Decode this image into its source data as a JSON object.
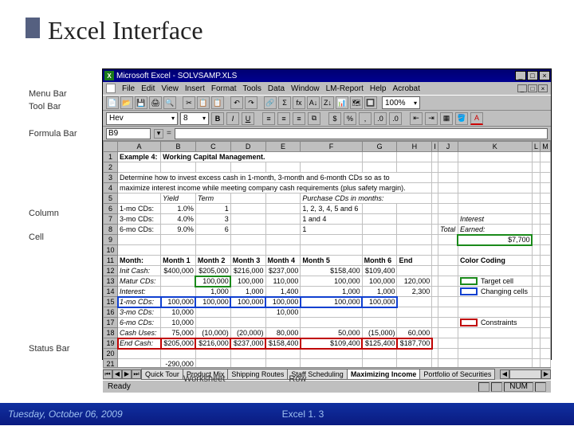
{
  "slide": {
    "title": "Excel Interface"
  },
  "annotations": {
    "menubar": "Menu Bar",
    "toolbar": "Tool Bar",
    "formulabar": "Formula Bar",
    "column": "Column",
    "cell": "Cell",
    "statusbar": "Status Bar",
    "worksheet": "Worksheet",
    "row": "Row"
  },
  "title": {
    "app": "Microsoft Excel",
    "file": "SOLVSAMP.XLS"
  },
  "winbtns": {
    "min": "_",
    "max": "□",
    "close": "×"
  },
  "menubar": {
    "items": [
      "File",
      "Edit",
      "View",
      "Insert",
      "Format",
      "Tools",
      "Data",
      "Window",
      "LM-Report",
      "Help",
      "Acrobat"
    ]
  },
  "toolbar": {
    "icons": [
      "📄",
      "📂",
      "💾",
      "🖨",
      "🔍",
      "✂",
      "📋",
      "📋",
      "↶",
      "↷",
      "🔗",
      "Σ",
      "fx",
      "A↓",
      "Z↓",
      "📊",
      "🗺",
      "🔲"
    ],
    "zoom": "100%"
  },
  "fmt": {
    "font": "Hev",
    "size": "8",
    "buttons": [
      "B",
      "I",
      "U"
    ],
    "align": [
      "≡",
      "≡",
      "≡",
      "≡"
    ],
    "money": "$",
    "pct": "%",
    "comma": ",",
    "fontcolor": "A"
  },
  "formula": {
    "cell": "B9",
    "eq": "="
  },
  "cols": [
    "A",
    "B",
    "C",
    "D",
    "E",
    "F",
    "G",
    "H",
    "I",
    "J",
    "K",
    "L",
    "M"
  ],
  "rows": [
    {
      "n": "1",
      "cells": [
        {
          "v": "Example 4:",
          "b": true
        },
        {
          "v": "Working Capital Management.",
          "b": true,
          "span": 5
        }
      ]
    },
    {
      "n": "2",
      "cells": []
    },
    {
      "n": "3",
      "cells": [
        {
          "span": 8,
          "v": "Determine how to invest excess cash in 1-month, 3-month and 6-month CDs so as to"
        }
      ]
    },
    {
      "n": "4",
      "cells": [
        {
          "span": 8,
          "v": "maximize interest income while meeting company cash requirements (plus safety margin)."
        }
      ]
    },
    {
      "n": "5",
      "cells": [
        {},
        {
          "v": "Yield",
          "i": true
        },
        {
          "v": "Term",
          "i": true
        },
        {},
        {},
        {
          "v": "Purchase CDs in months:",
          "i": true,
          "span": 3
        }
      ]
    },
    {
      "n": "6",
      "cells": [
        {
          "v": "1-mo CDs:"
        },
        {
          "v": "1.0%",
          "n": true
        },
        {
          "v": "1",
          "n": true
        },
        {},
        {},
        {
          "v": "1, 2, 3, 4, 5 and 6"
        }
      ]
    },
    {
      "n": "7",
      "cells": [
        {
          "v": "3-mo CDs:"
        },
        {
          "v": "4.0%",
          "n": true
        },
        {
          "v": "3",
          "n": true
        },
        {},
        {},
        {
          "v": "1 and 4"
        },
        {},
        {},
        {},
        {},
        {
          "v": "Interest",
          "i": true
        }
      ]
    },
    {
      "n": "8",
      "cells": [
        {
          "v": "6-mo CDs:"
        },
        {
          "v": "9.0%",
          "n": true
        },
        {
          "v": "6",
          "n": true
        },
        {},
        {},
        {
          "v": "1"
        },
        {},
        {},
        {},
        {
          "v": "Total",
          "i": true
        },
        {
          "v": "Earned:",
          "i": true
        }
      ]
    },
    {
      "n": "9",
      "cells": [
        {},
        {},
        {},
        {},
        {},
        {},
        {},
        {},
        {},
        {},
        {
          "v": "$7,700",
          "n": true,
          "green": true
        }
      ]
    },
    {
      "n": "10",
      "cells": []
    },
    {
      "n": "11",
      "cells": [
        {
          "v": "Month:",
          "b": true
        },
        {
          "v": "Month 1",
          "b": true
        },
        {
          "v": "Month 2",
          "b": true
        },
        {
          "v": "Month 3",
          "b": true
        },
        {
          "v": "Month 4",
          "b": true
        },
        {
          "v": "Month 5",
          "b": true
        },
        {
          "v": "Month 6",
          "b": true
        },
        {
          "v": "End",
          "b": true
        },
        {},
        {},
        {
          "v": "Color Coding",
          "b": true
        }
      ]
    },
    {
      "n": "12",
      "cells": [
        {
          "v": "Init Cash:",
          "i": true
        },
        {
          "v": "$400,000",
          "n": true
        },
        {
          "v": "$205,000",
          "n": true
        },
        {
          "v": "$216,000",
          "n": true
        },
        {
          "v": "$237,000",
          "n": true
        },
        {
          "v": "$158,400",
          "n": true
        },
        {
          "v": "$109,400",
          "n": true
        },
        {
          "v": ""
        }
      ]
    },
    {
      "n": "13",
      "cells": [
        {
          "v": "Matur CDs:",
          "i": true
        },
        {},
        {
          "v": "100,000",
          "n": true,
          "green": true
        },
        {
          "v": "100,000",
          "n": true
        },
        {
          "v": "110,000",
          "n": true
        },
        {
          "v": "100,000",
          "n": true
        },
        {
          "v": "100,000",
          "n": true
        },
        {
          "v": "120,000",
          "n": true
        },
        {},
        {},
        {
          "v": "",
          "legend": "green",
          "lt": "Target cell"
        }
      ]
    },
    {
      "n": "14",
      "cells": [
        {
          "v": "Interest:",
          "i": true
        },
        {},
        {
          "v": "1,000",
          "n": true
        },
        {
          "v": "1,000",
          "n": true
        },
        {
          "v": "1,400",
          "n": true
        },
        {
          "v": "1,000",
          "n": true
        },
        {
          "v": "1,000",
          "n": true
        },
        {
          "v": "2,300",
          "n": true
        },
        {},
        {},
        {
          "v": "",
          "legend": "blue",
          "lt": "Changing cells"
        }
      ]
    },
    {
      "n": "15",
      "cells": [
        {
          "v": "1-mo CDs:",
          "i": true,
          "blueRow": true
        },
        {
          "v": "100,000",
          "n": true
        },
        {
          "v": "100,000",
          "n": true
        },
        {
          "v": "100,000",
          "n": true
        },
        {
          "v": "100,000",
          "n": true
        },
        {
          "v": "100,000",
          "n": true
        },
        {
          "v": "100,000",
          "n": true
        }
      ]
    },
    {
      "n": "16",
      "cells": [
        {
          "v": "3-mo CDs:",
          "i": true
        },
        {
          "v": "10,000",
          "n": true
        },
        {},
        {},
        {
          "v": "10,000",
          "n": true
        }
      ]
    },
    {
      "n": "17",
      "cells": [
        {
          "v": "6-mo CDs:",
          "i": true
        },
        {
          "v": "10,000",
          "n": true
        },
        {},
        {},
        {},
        {},
        {},
        {},
        {},
        {},
        {
          "v": "",
          "legend": "red",
          "lt": "Constraints"
        }
      ]
    },
    {
      "n": "18",
      "cells": [
        {
          "v": "Cash Uses:",
          "i": true
        },
        {
          "v": "75,000",
          "n": true
        },
        {
          "v": "(10,000)",
          "n": true
        },
        {
          "v": "(20,000)",
          "n": true
        },
        {
          "v": "80,000",
          "n": true
        },
        {
          "v": "50,000",
          "n": true
        },
        {
          "v": "(15,000)",
          "n": true
        },
        {
          "v": "60,000",
          "n": true
        }
      ]
    },
    {
      "n": "19",
      "cells": [
        {
          "v": "End Cash:",
          "i": true,
          "redRow": true
        },
        {
          "v": "$205,000",
          "n": true
        },
        {
          "v": "$216,000",
          "n": true
        },
        {
          "v": "$237,000",
          "n": true
        },
        {
          "v": "$158,400",
          "n": true
        },
        {
          "v": "$109,400",
          "n": true
        },
        {
          "v": "$125,400",
          "n": true
        },
        {
          "v": "$187,700",
          "n": true
        }
      ]
    },
    {
      "n": "20",
      "cells": []
    },
    {
      "n": "21",
      "cells": [
        {},
        {
          "v": "-290,000",
          "n": true
        }
      ]
    }
  ],
  "tabs": {
    "items": [
      "Quick Tour",
      "Product Mix",
      "Shipping Routes",
      "Staff Scheduling",
      "Maximizing Income",
      "Portfolio of Securities"
    ],
    "active": 4
  },
  "status": {
    "ready": "Ready",
    "num": "NUM"
  },
  "footer": {
    "date": "Tuesday, October 06, 2009",
    "page": "Excel 1. 3"
  }
}
